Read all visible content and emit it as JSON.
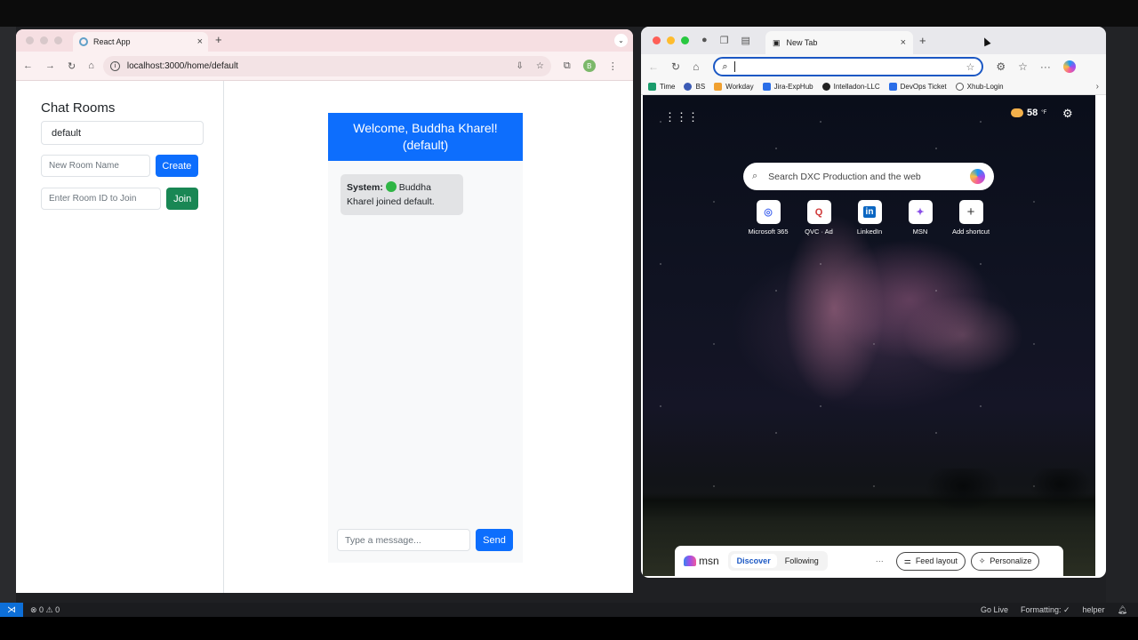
{
  "chrome": {
    "tab_title": "React App",
    "tab_close": "×",
    "new_tab": "+",
    "tab_menu": "⌄",
    "url": "localhost:3000/home/default",
    "profile_initial": "B"
  },
  "app": {
    "sidebar": {
      "title": "Chat Rooms",
      "rooms": [
        "default"
      ],
      "new_room_placeholder": "New Room Name",
      "create_label": "Create",
      "join_placeholder": "Enter Room ID to Join",
      "join_label": "Join"
    },
    "chat": {
      "header": "Welcome, Buddha Kharel! (default)",
      "messages": [
        {
          "sender": "System:",
          "text": "Buddha Kharel joined default."
        }
      ],
      "input_placeholder": "Type a message...",
      "send_label": "Send"
    }
  },
  "edge": {
    "tab_title": "New Tab",
    "tab_close": "×",
    "new_tab": "+",
    "favorites": [
      {
        "label": "Time",
        "color": "#1a9c6c"
      },
      {
        "label": "BS",
        "color": "#3b5bb5"
      },
      {
        "label": "Workday",
        "color": "#f0a030"
      },
      {
        "label": "Jira-ExpHub",
        "color": "#2a6ee8"
      },
      {
        "label": "Intelladon-LLC",
        "color": "#222222"
      },
      {
        "label": "DevOps Ticket",
        "color": "#2a6ee8"
      },
      {
        "label": "Xhub-Login",
        "color": "#555555"
      }
    ],
    "weather": {
      "temp": "58",
      "unit": "°F"
    },
    "search_placeholder": "Search DXC Production and the web",
    "shortcuts": [
      {
        "label": "Microsoft 365",
        "glyph": "◎",
        "color": "#4a6cf0"
      },
      {
        "label": "QVC · Ad",
        "glyph": "Q",
        "color": "#d03a3a"
      },
      {
        "label": "LinkedIn",
        "glyph": "in",
        "color": "#0a66c2"
      },
      {
        "label": "MSN",
        "glyph": "✦",
        "color": "#8a4fe8"
      },
      {
        "label": "Add shortcut",
        "glyph": "+",
        "color": "#333333"
      }
    ],
    "msn": {
      "logo": "msn",
      "tabs": [
        "Discover",
        "Following"
      ],
      "more": "···",
      "feed_layout": "Feed layout",
      "personalize": "Personalize"
    }
  },
  "status_bar": {
    "problems": "⊗ 0 ⚠ 0",
    "go_live": "Go Live",
    "formatting": "Formatting: ✓",
    "helper": "helper"
  }
}
